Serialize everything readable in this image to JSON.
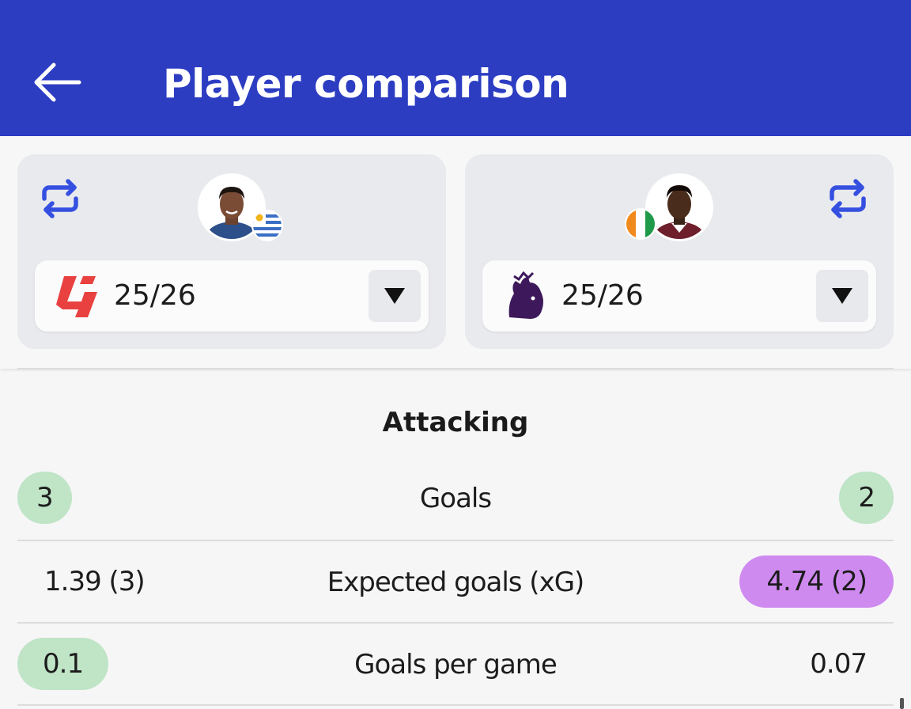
{
  "app_bar": {
    "title": "Player comparison",
    "back_icon": "arrow-left-icon",
    "background": "#2c3dc2"
  },
  "players": [
    {
      "swap_icon": "swap-arrows-icon",
      "avatar": "player-photo",
      "flag": "uruguay-flag",
      "league_logo": "laliga-logo",
      "season": "25/26"
    },
    {
      "swap_icon": "swap-arrows-icon",
      "avatar": "player-photo",
      "flag": "ivory-coast-flag",
      "league_logo": "premier-league-logo",
      "season": "25/26"
    }
  ],
  "section": {
    "title": "Attacking"
  },
  "stats": [
    {
      "label": "Goals",
      "left": "3",
      "right": "2",
      "left_highlight": "green",
      "right_highlight": "green"
    },
    {
      "label": "Expected goals (xG)",
      "left": "1.39 (3)",
      "right": "4.74 (2)",
      "left_highlight": "none",
      "right_highlight": "purple"
    },
    {
      "label": "Goals per game",
      "left": "0.1",
      "right": "0.07",
      "left_highlight": "green",
      "right_highlight": "none"
    }
  ],
  "colors": {
    "accent": "#2c3dc2",
    "swap_icon": "#3550e0",
    "highlight_green": "#bfe4c6",
    "highlight_purple": "#cf8af0"
  }
}
